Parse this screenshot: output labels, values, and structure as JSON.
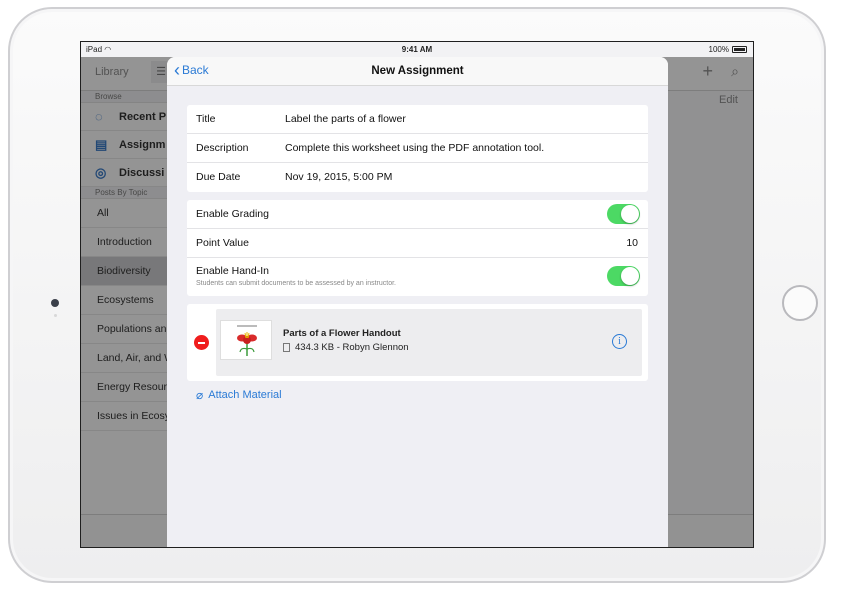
{
  "status_bar": {
    "device": "iPad",
    "time": "9:41 AM",
    "battery": "100%"
  },
  "background": {
    "library_label": "Library",
    "edit_label": "Edit",
    "browse_header": "Browse",
    "browse_items": [
      "Recent P",
      "Assignm",
      "Discussi"
    ],
    "topics_header": "Posts By Topic",
    "topics": [
      "All",
      "Introduction",
      "Biodiversity",
      "Ecosystems",
      "Populations an",
      "Land, Air, and W",
      "Energy Resour",
      "Issues in Ecosy"
    ],
    "selected_topic": "Biodiversity"
  },
  "modal": {
    "back_label": "Back",
    "title": "New Assignment",
    "details": [
      {
        "label": "Title",
        "value": "Label the parts of a flower"
      },
      {
        "label": "Description",
        "value": "Complete this worksheet using the PDF annotation tool."
      },
      {
        "label": "Due Date",
        "value": "Nov 19, 2015, 5:00 PM"
      }
    ],
    "grading": {
      "enable_grading_label": "Enable Grading",
      "enable_grading": true,
      "point_value_label": "Point Value",
      "point_value": "10",
      "hand_in_label": "Enable Hand-In",
      "hand_in_sub": "Students can submit documents to be assessed by an instructor.",
      "hand_in": true
    },
    "attachment": {
      "name": "Parts of a Flower Handout",
      "meta": "434.3 KB - Robyn Glennon"
    },
    "attach_label": "Attach Material"
  },
  "colors": {
    "accent": "#2a7ad5",
    "toggle_on": "#4cd964",
    "remove": "#f01d1d"
  }
}
